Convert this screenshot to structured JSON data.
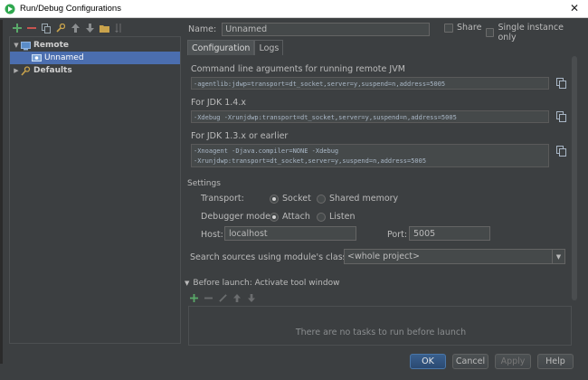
{
  "window": {
    "title": "Run/Debug Configurations",
    "close_glyph": "✕"
  },
  "left_toolbar": {
    "icons": [
      "add-icon",
      "remove-icon",
      "copy-icon",
      "wrench-icon",
      "move-up-icon",
      "move-down-icon",
      "folder-icon",
      "sort-icon"
    ]
  },
  "tree": {
    "items": [
      {
        "label": "Remote",
        "level": 0,
        "bold": true,
        "expanded": true,
        "selected": false
      },
      {
        "label": "Unnamed",
        "level": 1,
        "bold": false,
        "selected": true
      },
      {
        "label": "Defaults",
        "level": 0,
        "bold": true,
        "expanded": false,
        "selected": false
      }
    ]
  },
  "name_row": {
    "label": "Name:",
    "value": "Unnamed",
    "share_label": "Share",
    "share_checked": false,
    "single_instance_label": "Single instance only",
    "single_instance_checked": false
  },
  "tabs": [
    {
      "label": "Configuration",
      "active": true
    },
    {
      "label": "Logs",
      "active": false
    }
  ],
  "configuration": {
    "cmd_label": "Command line arguments for running remote JVM",
    "cmd_value": "-agentlib:jdwp=transport=dt_socket,server=y,suspend=n,address=5005",
    "jdk14_label": "For JDK 1.4.x",
    "jdk14_value": "-Xdebug -Xrunjdwp:transport=dt_socket,server=y,suspend=n,address=5005",
    "jdk13_label": "For JDK 1.3.x or earlier",
    "jdk13_line1": "-Xnoagent -Djava.compiler=NONE -Xdebug",
    "jdk13_line2": "-Xrunjdwp:transport=dt_socket,server=y,suspend=n,address=5005"
  },
  "settings": {
    "title": "Settings",
    "transport_label": "Transport:",
    "transport_options": [
      {
        "label": "Socket",
        "selected": true
      },
      {
        "label": "Shared memory",
        "selected": false
      }
    ],
    "debugger_mode_label": "Debugger mode:",
    "debugger_mode_options": [
      {
        "label": "Attach",
        "selected": true
      },
      {
        "label": "Listen",
        "selected": false
      }
    ],
    "host_label": "Host:",
    "host_value": "localhost",
    "port_label": "Port:",
    "port_value": "5005",
    "classpath_label": "Search sources using module's classpath:",
    "classpath_value": "<whole project>"
  },
  "before_launch": {
    "title": "Before launch: Activate tool window",
    "empty_text": "There are no tasks to run before launch"
  },
  "buttons": {
    "ok": "OK",
    "cancel": "Cancel",
    "apply": "Apply",
    "help": "Help"
  },
  "colors": {
    "accent": "#4b6eaf",
    "primary_button": "#395f8d",
    "background": "#3c3f41",
    "add_green": "#59a869",
    "remove_red": "#c75450"
  }
}
